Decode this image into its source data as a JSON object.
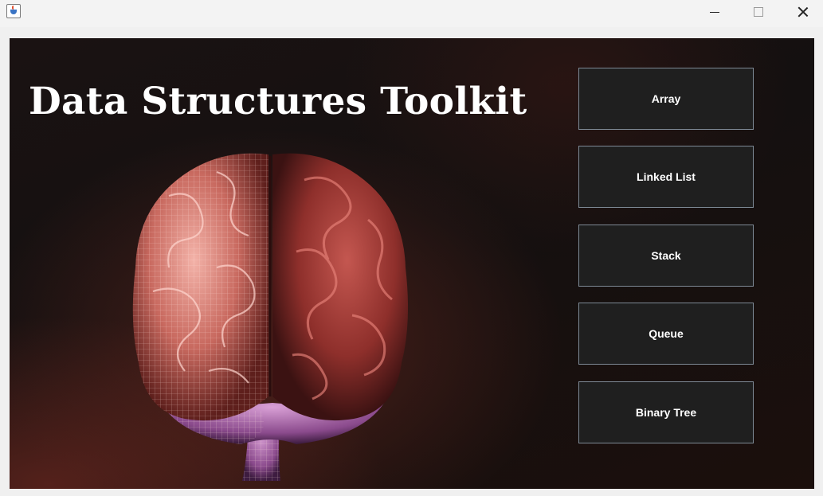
{
  "window": {
    "controls": {
      "minimize_icon": "minimize-icon",
      "maximize_icon": "maximize-icon",
      "close_icon": "close-icon"
    }
  },
  "main": {
    "title": "Data Structures Toolkit",
    "image": "brain-illustration",
    "buttons": [
      {
        "label": "Array"
      },
      {
        "label": "Linked List"
      },
      {
        "label": "Stack"
      },
      {
        "label": "Queue"
      },
      {
        "label": "Binary Tree"
      }
    ]
  },
  "colors": {
    "button_bg": "#1f1f1f",
    "button_border": "#7e8a96",
    "title_text": "#ffffff"
  }
}
